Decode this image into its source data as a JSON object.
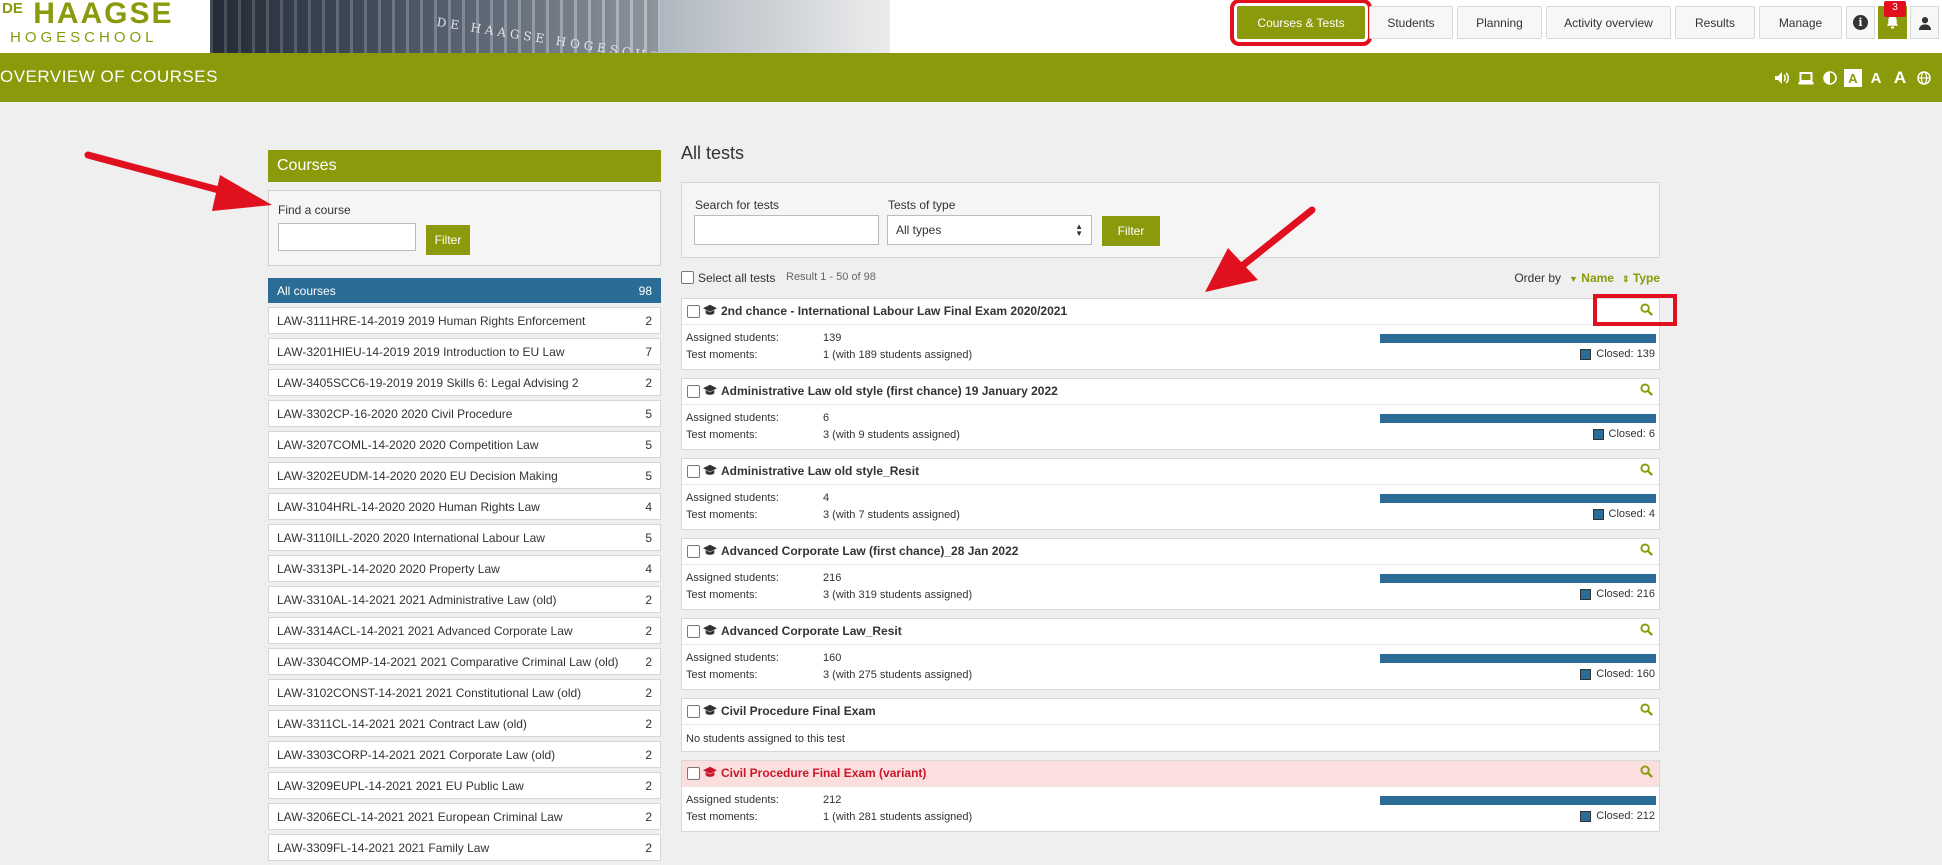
{
  "logo": {
    "line1_small": "DE",
    "line1": "HAAGSE",
    "line2": "HOGESCHOOL"
  },
  "banner_sign": "DE HAAGSE HOGESCHOOL",
  "nav": {
    "items": [
      {
        "label": "Courses & Tests",
        "active": true
      },
      {
        "label": "Students"
      },
      {
        "label": "Planning"
      },
      {
        "label": "Activity overview"
      },
      {
        "label": "Results"
      },
      {
        "label": "Manage"
      }
    ],
    "notification_count": "3"
  },
  "page_title": "OVERVIEW OF COURSES",
  "accessibility": {
    "text_a1": "A",
    "text_a2": "A",
    "text_a3": "A"
  },
  "courses_panel": {
    "heading": "Courses",
    "find_label": "Find a course",
    "filter_label": "Filter",
    "all_courses": {
      "name": "All courses",
      "count": "98"
    },
    "items": [
      {
        "name": "LAW-3111HRE-14-2019 2019 Human Rights Enforcement",
        "count": "2"
      },
      {
        "name": "LAW-3201HIEU-14-2019 2019 Introduction to EU Law",
        "count": "7"
      },
      {
        "name": "LAW-3405SCC6-19-2019 2019 Skills 6: Legal Advising 2",
        "count": "2"
      },
      {
        "name": "LAW-3302CP-16-2020 2020 Civil Procedure",
        "count": "5"
      },
      {
        "name": "LAW-3207COML-14-2020 2020 Competition Law",
        "count": "5"
      },
      {
        "name": "LAW-3202EUDM-14-2020 2020 EU Decision Making",
        "count": "5"
      },
      {
        "name": "LAW-3104HRL-14-2020 2020 Human Rights Law",
        "count": "4"
      },
      {
        "name": "LAW-3110ILL-2020 2020 International Labour Law",
        "count": "5"
      },
      {
        "name": "LAW-3313PL-14-2020 2020 Property Law",
        "count": "4"
      },
      {
        "name": "LAW-3310AL-14-2021 2021 Administrative Law (old)",
        "count": "2"
      },
      {
        "name": "LAW-3314ACL-14-2021 2021 Advanced Corporate Law",
        "count": "2"
      },
      {
        "name": "LAW-3304COMP-14-2021 2021 Comparative Criminal Law (old)",
        "count": "2"
      },
      {
        "name": "LAW-3102CONST-14-2021 2021 Constitutional Law (old)",
        "count": "2"
      },
      {
        "name": "LAW-3311CL-14-2021 2021 Contract Law (old)",
        "count": "2"
      },
      {
        "name": "LAW-3303CORP-14-2021 2021 Corporate Law (old)",
        "count": "2"
      },
      {
        "name": "LAW-3209EUPL-14-2021 2021 EU Public Law",
        "count": "2"
      },
      {
        "name": "LAW-3206ECL-14-2021 2021 European Criminal Law",
        "count": "2"
      },
      {
        "name": "LAW-3309FL-14-2021 2021 Family Law",
        "count": "2"
      }
    ]
  },
  "tests": {
    "heading": "All tests",
    "search_label": "Search for tests",
    "type_label": "Tests of type",
    "type_selected": "All types",
    "filter_label": "Filter",
    "select_all_label": "Select all tests",
    "result_text": "Result 1 - 50 of 98",
    "order_label": "Order by",
    "order_name": "Name",
    "order_type": "Type",
    "assigned_label": "Assigned students:",
    "moments_label": "Test moments:",
    "items": [
      {
        "title": "2nd chance - International Labour Law Final Exam 2020/2021",
        "assigned": "139",
        "moments": "1 (with 189 students assigned)",
        "closed": "Closed: 139"
      },
      {
        "title": "Administrative Law old style (first chance) 19 January 2022",
        "assigned": "6",
        "moments": "3 (with 9 students assigned)",
        "closed": "Closed: 6"
      },
      {
        "title": "Administrative Law old style_Resit",
        "assigned": "4",
        "moments": "3 (with 7 students assigned)",
        "closed": "Closed: 4"
      },
      {
        "title": "Advanced Corporate Law (first chance)_28 Jan 2022",
        "assigned": "216",
        "moments": "3 (with 319 students assigned)",
        "closed": "Closed: 216"
      },
      {
        "title": "Advanced Corporate Law_Resit",
        "assigned": "160",
        "moments": "3 (with 275 students assigned)",
        "closed": "Closed: 160"
      },
      {
        "title": "Civil Procedure Final Exam",
        "no_students": "No students assigned to this test"
      },
      {
        "title": "Civil Procedure Final Exam (variant)",
        "assigned": "212",
        "moments": "1 (with 281 students assigned)",
        "closed": "Closed: 212"
      }
    ]
  },
  "colors": {
    "brand": "#8a9a0b",
    "blue": "#2a6c96",
    "annotation_red": "#e0101f"
  }
}
